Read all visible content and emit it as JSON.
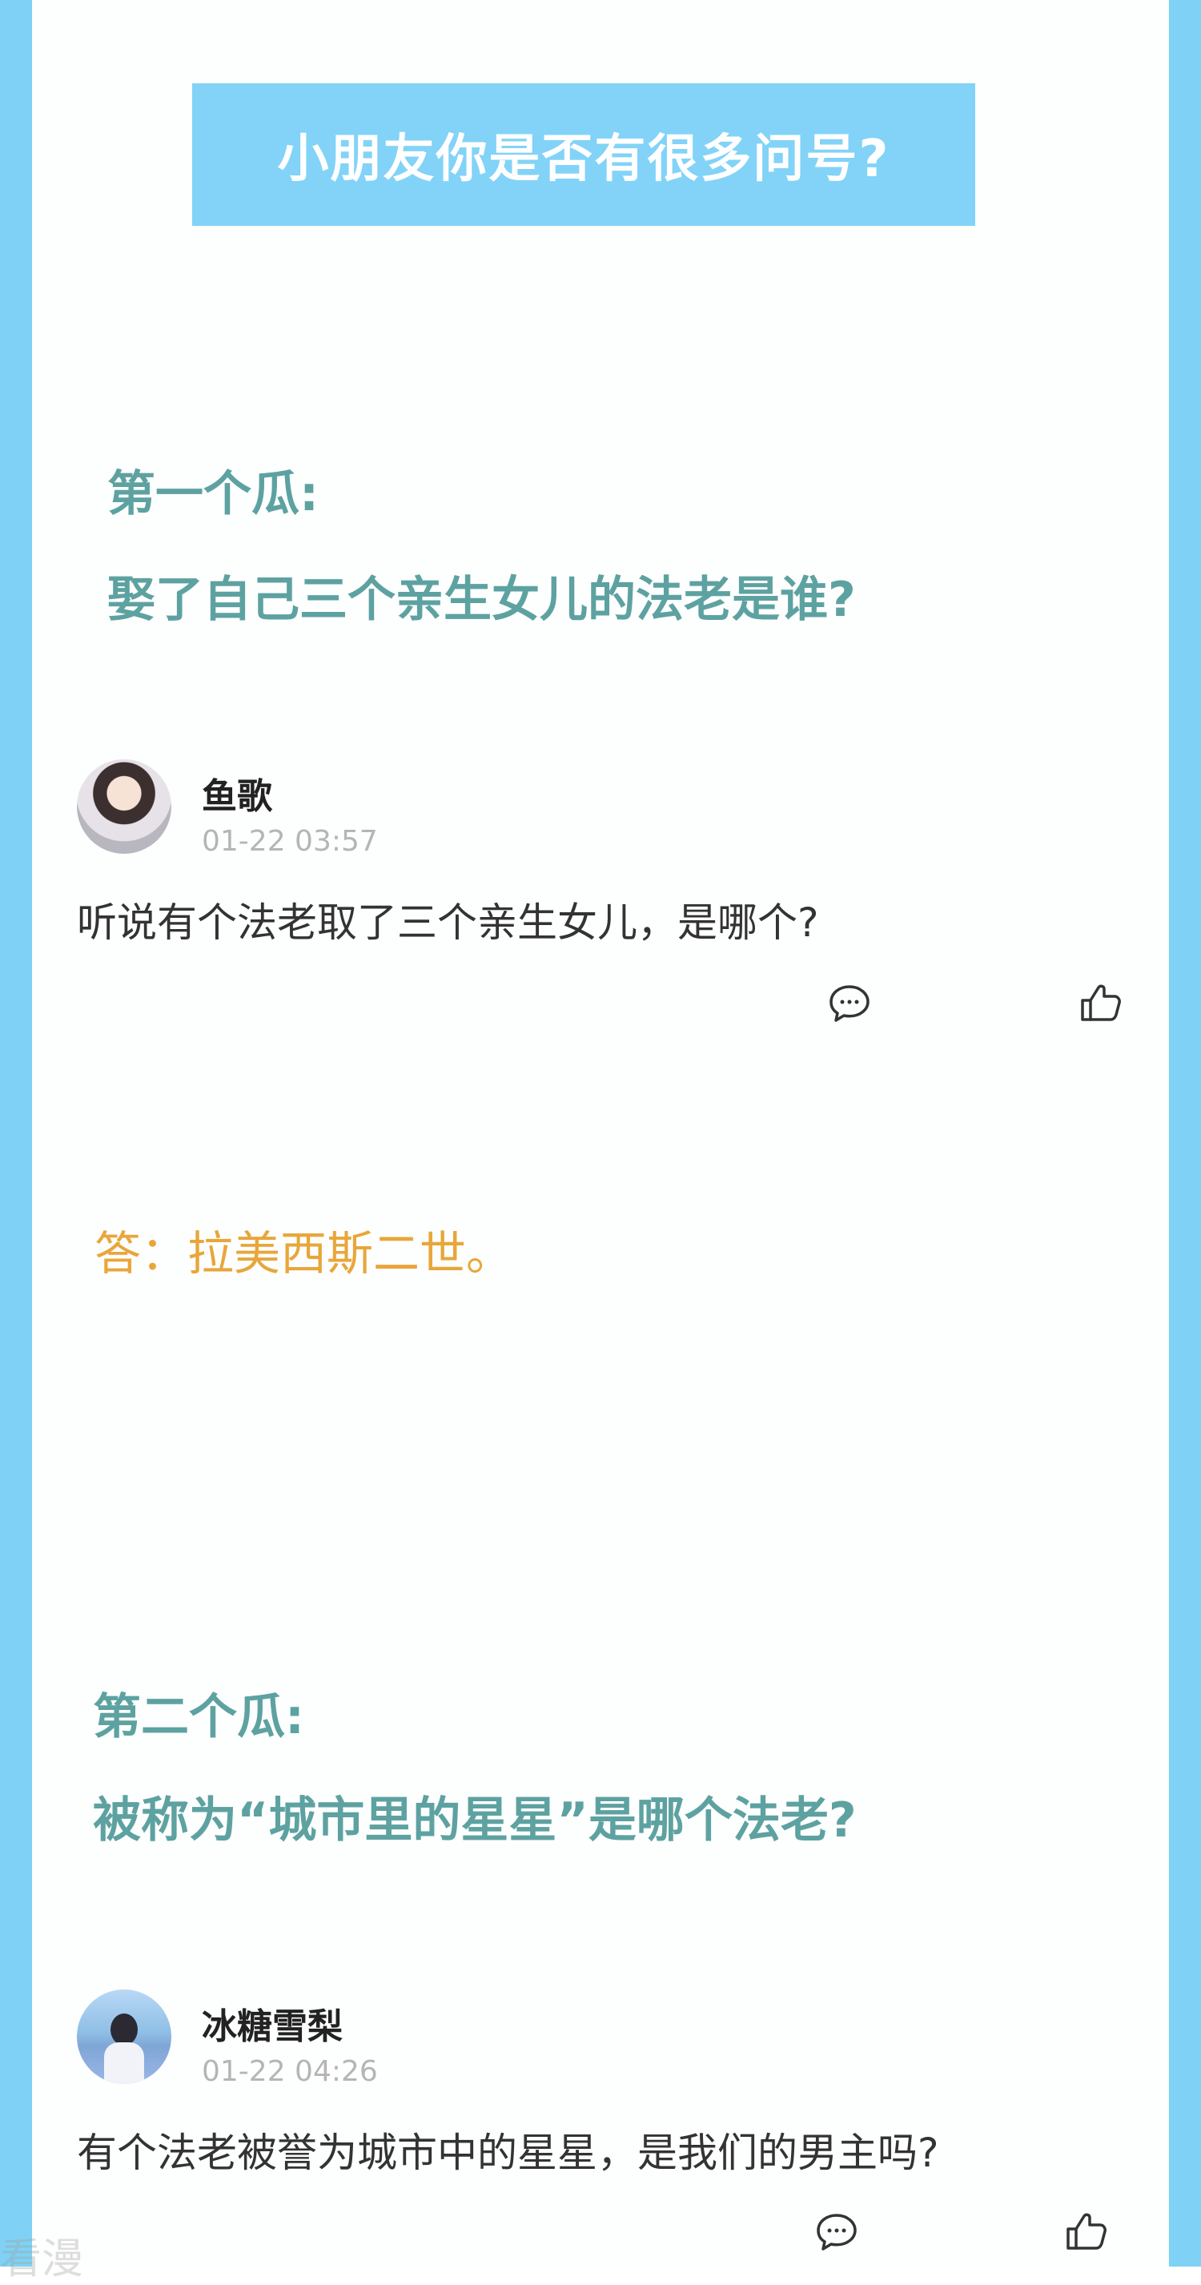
{
  "banner": {
    "title": "小朋友你是否有很多问号?"
  },
  "question1": {
    "label": "第一个瓜:",
    "text": "娶了自己三个亲生女儿的法老是谁?"
  },
  "post1": {
    "username": "鱼歌",
    "timestamp": "01-22 03:57",
    "comment": "听说有个法老取了三个亲生女儿，是哪个?",
    "reply_icon": "comment-bubble-icon",
    "like_icon": "thumbs-up-icon"
  },
  "answer1": {
    "text": "答：拉美西斯二世。"
  },
  "question2": {
    "label": "第二个瓜:",
    "text": "被称为“城市里的星星”是哪个法老?"
  },
  "post2": {
    "username": "冰糖雪梨",
    "timestamp": "01-22 04:26",
    "comment": "有个法老被誉为城市中的星星，是我们的男主吗?",
    "reply_icon": "comment-bubble-icon",
    "like_icon": "thumbs-up-icon"
  },
  "watermark": {
    "text": "看漫"
  },
  "colors": {
    "frame": "#7fd2f5",
    "banner": "#82d3f7",
    "question": "#5da2a1",
    "answer": "#e8a63a"
  }
}
